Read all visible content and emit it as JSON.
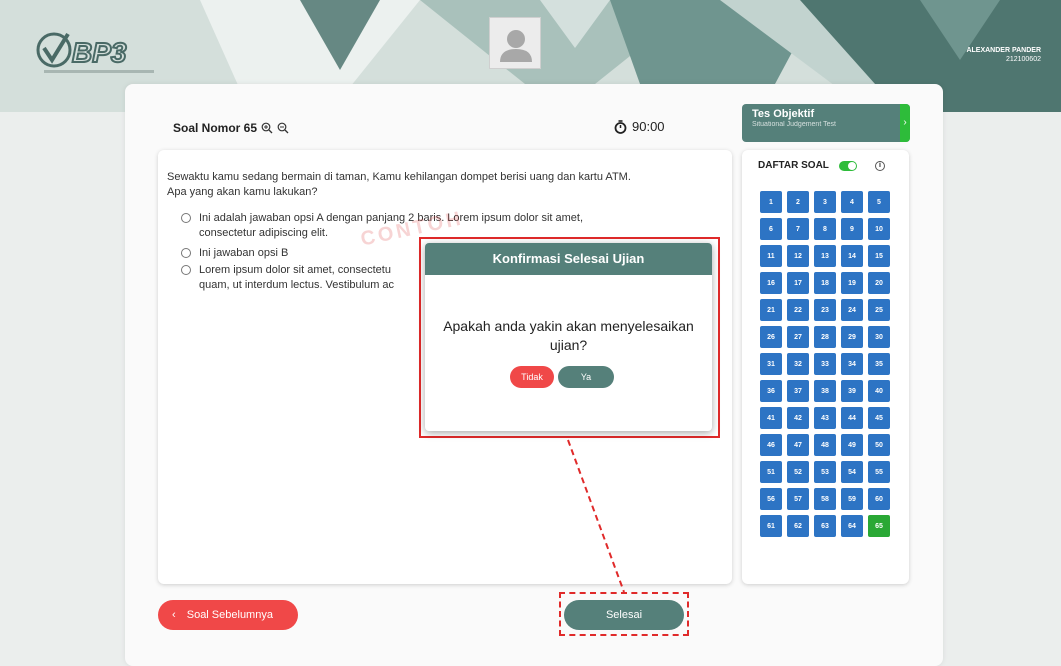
{
  "header": {
    "logo_text": "BP3",
    "user_name": "ALEXANDER PANDER",
    "user_id": "212100602"
  },
  "question": {
    "title": "Soal Nomor 65",
    "timer": "90:00",
    "text": "Sewaktu kamu sedang bermain di taman, Kamu kehilangan dompet berisi uang dan kartu ATM. Apa yang akan kamu lakukan?",
    "options": [
      "Ini adalah jawaban opsi A dengan panjang 2 baris. Lorem ipsum dolor sit amet, consectetur adipiscing elit.",
      "Ini jawaban opsi B",
      "Lorem ipsum dolor sit amet, consectetu quam, ut interdum lectus. Vestibulum ac"
    ],
    "watermark": "CONTOH"
  },
  "modal": {
    "title": "Konfirmasi Selesai Ujian",
    "message": "Apakah anda yakin akan menyelesaikan ujian?",
    "no_label": "Tidak",
    "yes_label": "Ya"
  },
  "sidebar": {
    "test_title": "Tes Objektif",
    "test_subtitle": "Situational Judgement Test",
    "list_title": "DAFTAR SOAL",
    "numbers": [
      "1",
      "2",
      "3",
      "4",
      "5",
      "6",
      "7",
      "8",
      "9",
      "10",
      "11",
      "12",
      "13",
      "14",
      "15",
      "16",
      "17",
      "18",
      "19",
      "20",
      "21",
      "22",
      "23",
      "24",
      "25",
      "26",
      "27",
      "28",
      "29",
      "30",
      "31",
      "32",
      "33",
      "34",
      "35",
      "36",
      "37",
      "38",
      "39",
      "40",
      "41",
      "42",
      "43",
      "44",
      "45",
      "46",
      "47",
      "48",
      "49",
      "50",
      "51",
      "52",
      "53",
      "54",
      "55",
      "56",
      "57",
      "58",
      "59",
      "60",
      "61",
      "62",
      "63",
      "64",
      "65"
    ],
    "active_number": "65"
  },
  "footer": {
    "prev_label": "Soal Sebelumnya",
    "finish_label": "Selesai"
  },
  "colors": {
    "primary": "#55807a",
    "danger": "#f04848",
    "question_cell": "#2d74c4",
    "active_cell": "#2aa835"
  }
}
